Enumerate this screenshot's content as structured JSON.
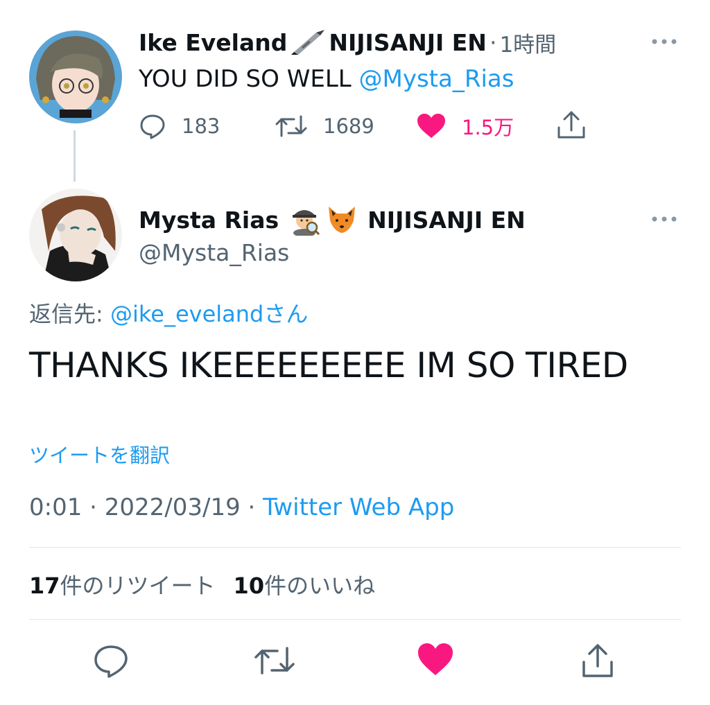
{
  "parent_tweet": {
    "author_name": "Ike Eveland",
    "author_org": "NIJISANJI EN",
    "separator": "·",
    "time": "1時間",
    "text": "YOU DID SO WELL ",
    "mention": "@Mysta_Rias",
    "actions": {
      "reply_count": "183",
      "retweet_count": "1689",
      "like_count": "1.5万"
    }
  },
  "main_tweet": {
    "author_name": "Mysta Rias",
    "author_org": "NIJISANJI EN",
    "handle": "@Mysta_Rias",
    "reply_to_label": "返信先: ",
    "reply_to_handle": "@ike_evelandさん",
    "text": "THANKS IKEEEEEEEEE IM SO TIRED",
    "translate": "ツイートを翻訳",
    "timestamp": "0:01 · 2022/03/19 · ",
    "source": "Twitter Web App",
    "stats": {
      "retweets_num": "17",
      "retweets_label": "件のリツイート",
      "likes_num": "10",
      "likes_label": "件のいいね"
    }
  },
  "icons": {
    "brush": "brush-icon",
    "detective": "detective-emoji",
    "fox": "fox-emoji",
    "more": "more-icon",
    "reply": "reply-icon",
    "retweet": "retweet-icon",
    "like": "heart-icon",
    "share": "share-icon"
  },
  "colors": {
    "accent": "#1d9bf0",
    "like": "#f91880",
    "text": "#0f1419",
    "secondary": "#536471"
  }
}
